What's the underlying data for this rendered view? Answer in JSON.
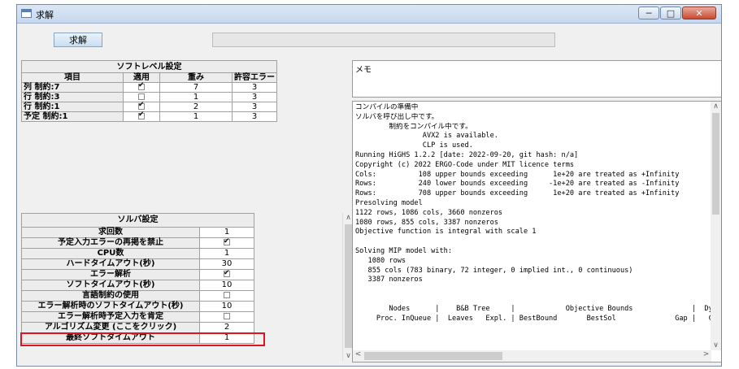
{
  "window": {
    "title": "求解",
    "minimize_glyph": "─",
    "maximize_glyph": "□",
    "close_glyph": "✕"
  },
  "toolbar": {
    "solve_label": "求解"
  },
  "soft_level": {
    "title": "ソフトレベル設定",
    "headers": [
      "項目",
      "適用",
      "重み",
      "許容エラー"
    ],
    "rows": [
      {
        "item": "列 制約:7",
        "apply": true,
        "weight": "7",
        "tolerance": "3"
      },
      {
        "item": "行 制約:3",
        "apply": false,
        "weight": "1",
        "tolerance": "3"
      },
      {
        "item": "行 制約:1",
        "apply": true,
        "weight": "2",
        "tolerance": "3"
      },
      {
        "item": "予定 制約:1",
        "apply": true,
        "weight": "1",
        "tolerance": "3"
      }
    ]
  },
  "solver": {
    "title": "ソルバ設定",
    "rows": [
      {
        "label": "求回数",
        "value": "1"
      },
      {
        "label": "予定入力エラーの再掲を禁止",
        "check": true
      },
      {
        "label": "CPU数",
        "value": "1"
      },
      {
        "label": "ハードタイムアウト(秒)",
        "value": "30"
      },
      {
        "label": "エラー解析",
        "check": true
      },
      {
        "label": "ソフトタイムアウト(秒)",
        "value": "10"
      },
      {
        "label": "言語制約の使用",
        "check": false
      },
      {
        "label": "エラー解析時のソフトタイムアウト(秒)",
        "value": "10"
      },
      {
        "label": "エラー解析時予定入力を肯定",
        "check": false
      },
      {
        "label": "アルゴリズム変更 (ここをクリック)",
        "value": "2"
      },
      {
        "label": "最終ソフトタイムアウト",
        "value": "1"
      }
    ]
  },
  "memo": {
    "label": "メモ"
  },
  "log": {
    "lines": [
      "コンパイルの準備中",
      "ソルバを呼び出し中です。",
      "        制約をコンパイル中です。",
      "                AVX2 is available.",
      "                CLP is used.",
      "Running HiGHS 1.2.2 [date: 2022-09-20, git hash: n/a]",
      "Copyright (c) 2022 ERGO-Code under MIT licence terms",
      "Cols:          108 upper bounds exceeding      1e+20 are treated as +Infinity",
      "Rows:          240 lower bounds exceeding     -1e+20 are treated as -Infinity",
      "Rows:          708 upper bounds exceeding      1e+20 are treated as +Infinity",
      "Presolving model",
      "1122 rows, 1086 cols, 3660 nonzeros",
      "1080 rows, 855 cols, 3387 nonzeros",
      "Objective function is integral with scale 1",
      "",
      "Solving MIP model with:",
      "   1080 rows",
      "   855 cols (783 binary, 72 integer, 0 implied int., 0 continuous)",
      "   3387 nonzeros",
      "",
      "",
      "        Nodes      |    B&B Tree     |            Objective Bounds              |  Dyn",
      "     Proc. InQueue |  Leaves   Expl. | BestBound       BestSol              Gap |   Cu"
    ]
  },
  "scroll_glyphs": {
    "up": "∧",
    "down": "∨",
    "left": "<",
    "right": ">"
  }
}
